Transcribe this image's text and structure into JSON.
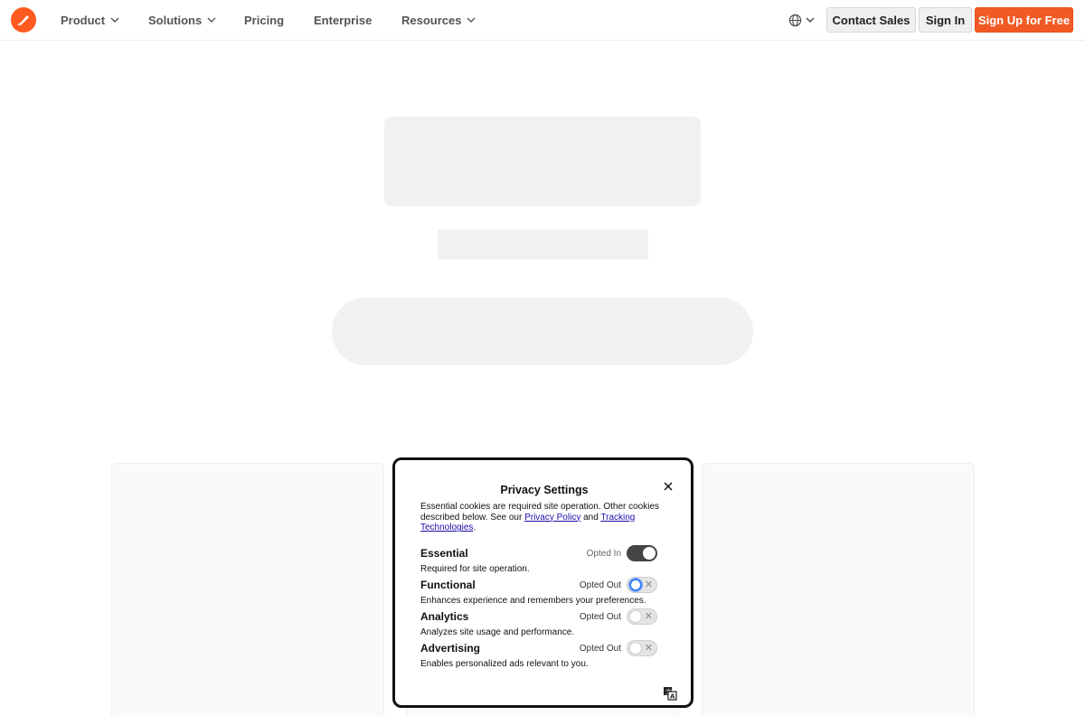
{
  "header": {
    "nav": [
      {
        "label": "Product",
        "dropdown": true
      },
      {
        "label": "Solutions",
        "dropdown": true
      },
      {
        "label": "Pricing",
        "dropdown": false
      },
      {
        "label": "Enterprise",
        "dropdown": false
      },
      {
        "label": "Resources",
        "dropdown": true
      }
    ],
    "language_icon": "globe-icon",
    "contact_label": "Contact Sales",
    "signin_label": "Sign In",
    "signup_label": "Sign Up for Free",
    "accent_color": "#f15a24"
  },
  "privacy": {
    "title": "Privacy Settings",
    "desc_prefix": "Essential cookies are required site operation. Other cookies described below. See our ",
    "privacy_link": "Privacy Policy",
    "desc_and": " and ",
    "tracking_link": "Tracking Technologies",
    "desc_suffix": ".",
    "categories": [
      {
        "name": "Essential",
        "description": "Required for site operation.",
        "status": "Opted In",
        "enabled": true
      },
      {
        "name": "Functional",
        "description": "Enhances experience and remembers your preferences.",
        "status": "Opted Out",
        "enabled": false
      },
      {
        "name": "Analytics",
        "description": "Analyzes site usage and performance.",
        "status": "Opted Out",
        "enabled": false
      },
      {
        "name": "Advertising",
        "description": "Enables personalized ads relevant to you.",
        "status": "Opted Out",
        "enabled": false
      }
    ]
  }
}
